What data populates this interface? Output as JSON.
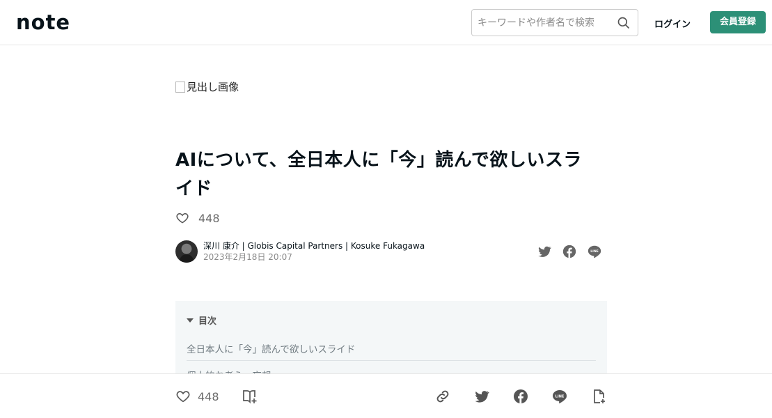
{
  "header": {
    "logo": "note",
    "search_placeholder": "キーワードや作者名で検索",
    "login_label": "ログイン",
    "signup_label": "会員登録",
    "accent_color": "#2c9077"
  },
  "article": {
    "hero_alt": "見出し画像",
    "title": "AIについて、全日本人に「今」読んで欲しいスライド",
    "like_count": "448",
    "author_name": "深川 康介 | Globis Capital Partners | Kosuke Fukagawa",
    "published": "2023年2月18日 20:07"
  },
  "toc": {
    "heading": "目次",
    "items": [
      "全日本人に「今」読んで欲しいスライド",
      "個人的お考え・妄想"
    ]
  },
  "footer_bar": {
    "like_count": "448"
  },
  "icons": [
    "search-icon",
    "heart-icon",
    "twitter-icon",
    "facebook-icon",
    "line-icon",
    "link-icon",
    "magazine-add-icon",
    "note-add-icon"
  ]
}
